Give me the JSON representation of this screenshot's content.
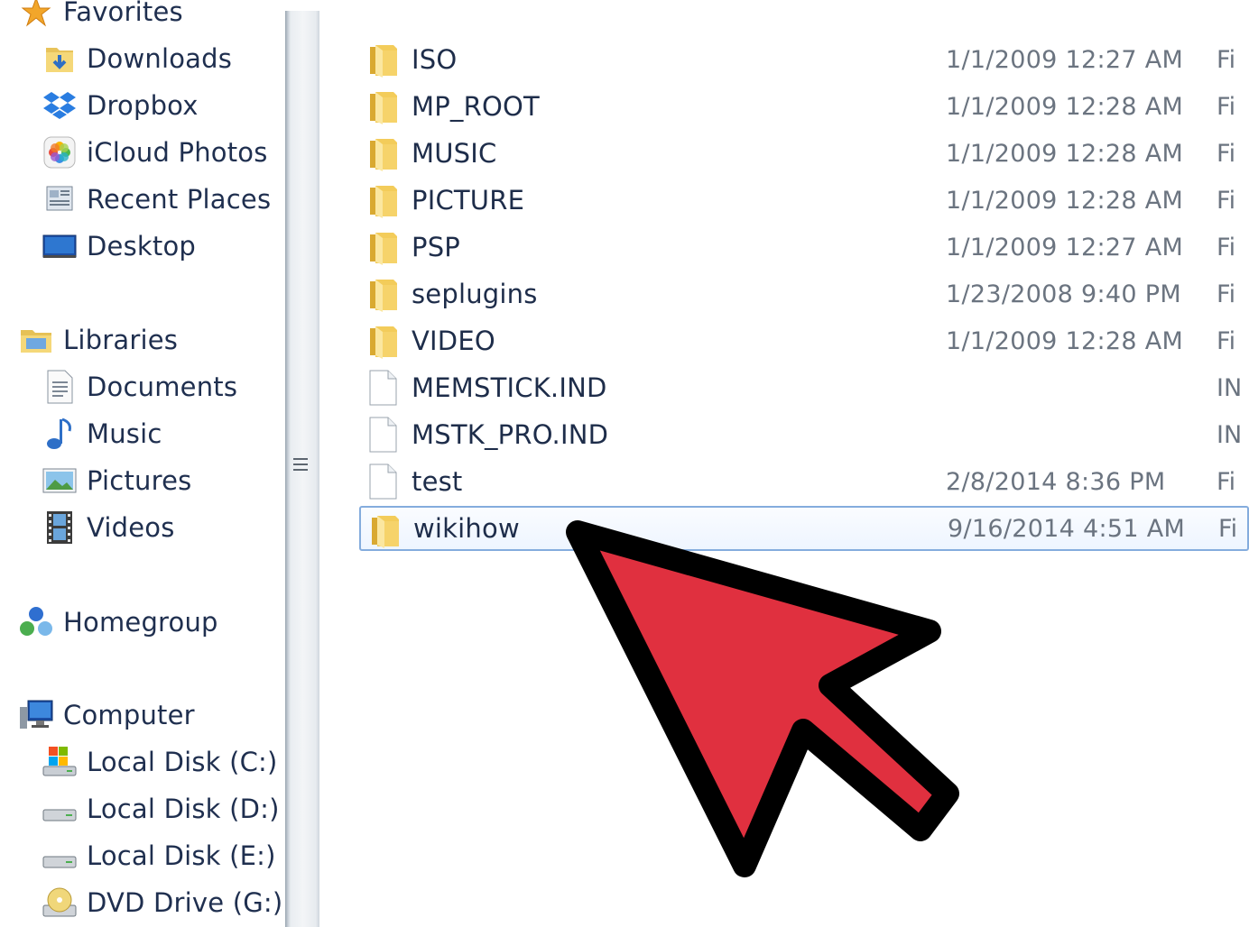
{
  "nav": {
    "favorites": "Favorites",
    "favorites_items": [
      {
        "label": "Downloads",
        "icon": "downloads-folder-icon"
      },
      {
        "label": "Dropbox",
        "icon": "dropbox-icon"
      },
      {
        "label": "iCloud Photos",
        "icon": "icloud-photos-icon"
      },
      {
        "label": "Recent Places",
        "icon": "recent-places-icon"
      },
      {
        "label": "Desktop",
        "icon": "desktop-icon"
      }
    ],
    "libraries": "Libraries",
    "libraries_items": [
      {
        "label": "Documents",
        "icon": "documents-icon"
      },
      {
        "label": "Music",
        "icon": "music-icon"
      },
      {
        "label": "Pictures",
        "icon": "pictures-icon"
      },
      {
        "label": "Videos",
        "icon": "videos-icon"
      }
    ],
    "homegroup": "Homegroup",
    "computer": "Computer",
    "computer_items": [
      {
        "label": "Local Disk (C:)",
        "icon": "system-disk-icon"
      },
      {
        "label": "Local Disk (D:)",
        "icon": "disk-drive-icon"
      },
      {
        "label": "Local Disk (E:)",
        "icon": "disk-drive-icon"
      },
      {
        "label": "DVD Drive (G:) O",
        "icon": "dvd-drive-icon"
      }
    ]
  },
  "files": [
    {
      "name": "ISO",
      "date": "1/1/2009 12:27 AM",
      "type": "Fi",
      "kind": "folder"
    },
    {
      "name": "MP_ROOT",
      "date": "1/1/2009 12:28 AM",
      "type": "Fi",
      "kind": "folder"
    },
    {
      "name": "MUSIC",
      "date": "1/1/2009 12:28 AM",
      "type": "Fi",
      "kind": "folder"
    },
    {
      "name": "PICTURE",
      "date": "1/1/2009 12:28 AM",
      "type": "Fi",
      "kind": "folder"
    },
    {
      "name": "PSP",
      "date": "1/1/2009 12:27 AM",
      "type": "Fi",
      "kind": "folder"
    },
    {
      "name": "seplugins",
      "date": "1/23/2008 9:40 PM",
      "type": "Fi",
      "kind": "folder"
    },
    {
      "name": "VIDEO",
      "date": "1/1/2009 12:28 AM",
      "type": "Fi",
      "kind": "folder"
    },
    {
      "name": "MEMSTICK.IND",
      "date": "",
      "type": "IN",
      "kind": "file"
    },
    {
      "name": "MSTK_PRO.IND",
      "date": "",
      "type": "IN",
      "kind": "file"
    },
    {
      "name": "test",
      "date": "2/8/2014 8:36 PM",
      "type": "Fi",
      "kind": "file"
    },
    {
      "name": "wikihow",
      "date": "9/16/2014 4:51 AM",
      "type": "Fi",
      "kind": "folder",
      "selected": true
    }
  ],
  "colors": {
    "arrow_fill": "#e0303f",
    "arrow_outline": "#000000",
    "selection_border": "#84acdd"
  }
}
